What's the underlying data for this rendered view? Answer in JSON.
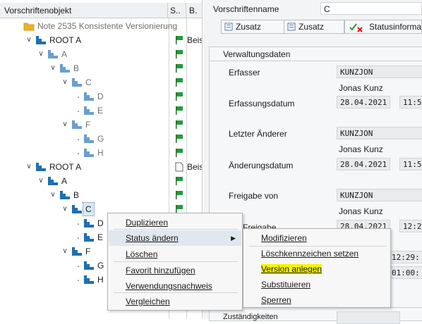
{
  "tree": {
    "header_object": "Vorschriftenobjekt",
    "header_s": "S..",
    "header_b": "B.",
    "nodes": [
      {
        "label": "Note 2535 Konsistente Versionierung",
        "icon": "folder-icon",
        "b": ""
      },
      {
        "label": "ROOT A",
        "icon": "hierarchy-icon",
        "b": "Beispiel"
      },
      {
        "label": "A",
        "icon": "hierarchy-icon",
        "b": ""
      },
      {
        "label": "B",
        "icon": "hierarchy-icon",
        "b": ""
      },
      {
        "label": "C",
        "icon": "hierarchy-icon",
        "b": ""
      },
      {
        "label": "D",
        "icon": "hierarchy-icon",
        "b": ""
      },
      {
        "label": "E",
        "icon": "hierarchy-icon",
        "b": ""
      },
      {
        "label": "F",
        "icon": "hierarchy-icon",
        "b": ""
      },
      {
        "label": "G",
        "icon": "hierarchy-icon",
        "b": ""
      },
      {
        "label": "H",
        "icon": "hierarchy-icon",
        "b": ""
      },
      {
        "label": "ROOT A",
        "icon": "hierarchy-icon",
        "b": "Beispiel"
      },
      {
        "label": "A",
        "icon": "hierarchy-icon",
        "b": ""
      },
      {
        "label": "B",
        "icon": "hierarchy-icon",
        "b": ""
      },
      {
        "label": "C",
        "icon": "hierarchy-icon",
        "b": ""
      },
      {
        "label": "D",
        "icon": "hierarchy-icon",
        "b": ""
      },
      {
        "label": "E",
        "icon": "hierarchy-icon",
        "b": ""
      },
      {
        "label": "F",
        "icon": "hierarchy-icon",
        "b": ""
      },
      {
        "label": "G",
        "icon": "hierarchy-icon",
        "b": ""
      },
      {
        "label": "H",
        "icon": "hierarchy-icon",
        "b": ""
      }
    ]
  },
  "detail": {
    "name_label": "Vorschriftenname",
    "name_value": "C",
    "toolbar": {
      "zusatz1": "Zusatz",
      "zusatz2": "Zusatz",
      "status": "Statusinformation"
    },
    "group_title": "Verwaltungsdaten",
    "erfasser_label": "Erfasser",
    "erfasser_id": "KUNZJON",
    "erfasser_name": "Jonas Kunz",
    "erfassungsdatum_label": "Erfassungsdatum",
    "erfassungsdatum_value": "28.04.2021",
    "erfassungszeit_value": "11:5",
    "aenderer_label": "Letzter Änderer",
    "aenderer_id": "KUNZJON",
    "aenderer_name": "Jonas Kunz",
    "aenderungsdatum_label": "Änderungsdatum",
    "aenderungsdatum_value": "28.04.2021",
    "aenderungszeit_value": "11:5",
    "freigabe_label": "Freigabe von",
    "freigabe_id": "KUNZJON",
    "freigabe_name": "Jonas Kunz",
    "freigabedatum_label_partial": "um Freigabe",
    "freigabedatum_value": "28.04.2021",
    "freigabezeit_value": "12:2",
    "time_hidden_1": "12:29:",
    "time_hidden_2": "01:00:",
    "zustaendigkeit_partial": "Zuständigkeiten"
  },
  "context_menu": {
    "items": [
      "Duplizieren",
      "Status ändern",
      "Löschen",
      "Favorit hinzufügen",
      "Verwendungsnachweis",
      "Vergleichen"
    ],
    "active_index": 1
  },
  "submenu": {
    "items": [
      "Modifizieren",
      "Löschkennzeichen setzen",
      "Version anlegen",
      "Substituieren",
      "Sperren"
    ],
    "highlighted_index": 2
  },
  "colors": {
    "accent_blue": "#1f6fb2",
    "flag_green": "#1e9e3a",
    "highlight_yellow": "#f6f400",
    "folder_orange": "#f0b323"
  }
}
